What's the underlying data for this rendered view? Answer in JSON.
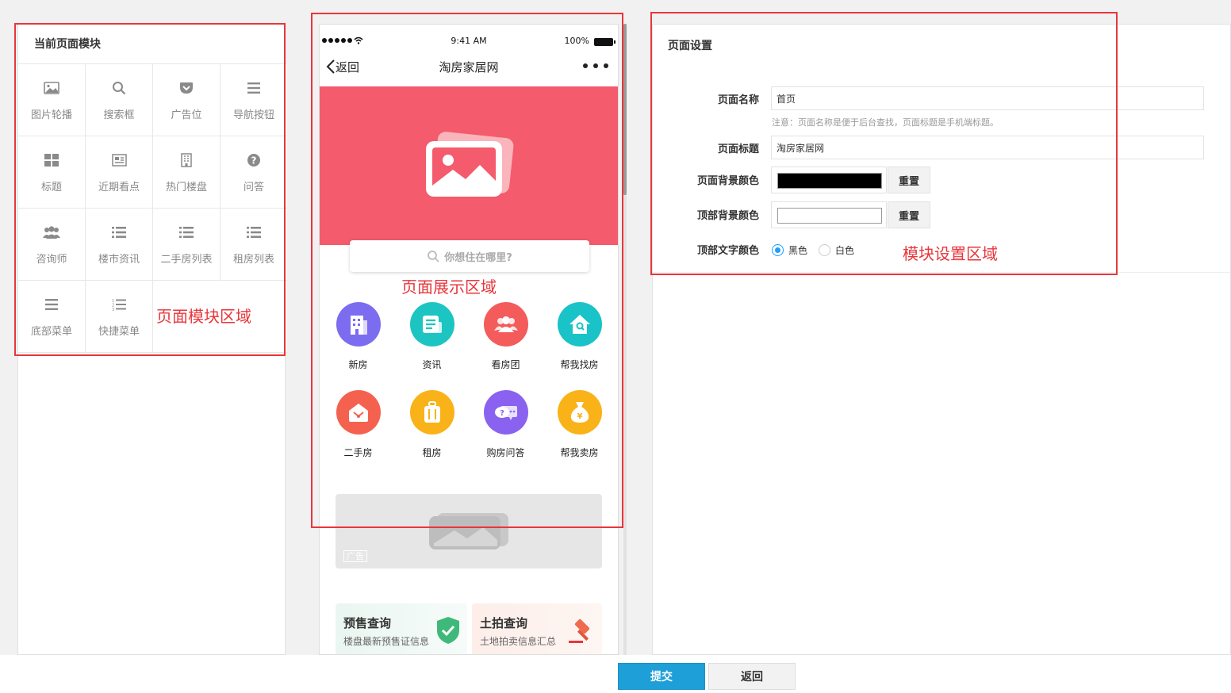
{
  "left_panel": {
    "title": "当前页面模块",
    "modules": [
      {
        "label": "图片轮播",
        "icon": "image-icon"
      },
      {
        "label": "搜索框",
        "icon": "search-icon"
      },
      {
        "label": "广告位",
        "icon": "pocket-icon"
      },
      {
        "label": "导航按钮",
        "icon": "menu-icon"
      },
      {
        "label": "标题",
        "icon": "grid-icon"
      },
      {
        "label": "近期看点",
        "icon": "newspaper-icon"
      },
      {
        "label": "热门楼盘",
        "icon": "building-icon"
      },
      {
        "label": "问答",
        "icon": "question-icon"
      },
      {
        "label": "咨询师",
        "icon": "users-icon"
      },
      {
        "label": "楼市资讯",
        "icon": "list-icon"
      },
      {
        "label": "二手房列表",
        "icon": "list-icon"
      },
      {
        "label": "租房列表",
        "icon": "list-icon"
      },
      {
        "label": "底部菜单",
        "icon": "menu-icon"
      },
      {
        "label": "快捷菜单",
        "icon": "list-ordered-icon"
      }
    ],
    "annotation": "页面模块区域"
  },
  "phone": {
    "status_time": "9:41 AM",
    "battery_text": "100%",
    "back_label": "返回",
    "nav_title": "淘房家居网",
    "search_placeholder": "你想住在哪里?",
    "annotation": "页面展示区域",
    "nav_items": [
      {
        "label": "新房",
        "color": "#7b6cf0",
        "icon": "building-icon"
      },
      {
        "label": "资讯",
        "color": "#1cc5c2",
        "icon": "news-icon"
      },
      {
        "label": "看房团",
        "color": "#f45b5b",
        "icon": "group-icon"
      },
      {
        "label": "帮我找房",
        "color": "#19c3c7",
        "icon": "house-search-icon"
      },
      {
        "label": "二手房",
        "color": "#f4624f",
        "icon": "house-icon"
      },
      {
        "label": "租房",
        "color": "#f9b218",
        "icon": "luggage-icon"
      },
      {
        "label": "购房问答",
        "color": "#8a62f0",
        "icon": "chat-icon"
      },
      {
        "label": "帮我卖房",
        "color": "#f9b218",
        "icon": "money-bag-icon"
      }
    ],
    "ad_tag": "广告",
    "promos": [
      {
        "title": "预售查询",
        "subtitle": "楼盘最新预售证信息",
        "icon": "shield-check-icon"
      },
      {
        "title": "土拍查询",
        "subtitle": "土地拍卖信息汇总",
        "icon": "gavel-icon"
      }
    ],
    "banner_color": "#f45b6c"
  },
  "settings": {
    "title": "页面设置",
    "page_name_label": "页面名称",
    "page_name_value": "首页",
    "page_name_hint": "注意：页面名称是便于后台查找，页面标题是手机端标题。",
    "page_title_label": "页面标题",
    "page_title_value": "淘房家居网",
    "bg_color_label": "页面背景颜色",
    "bg_color_value": "#000000",
    "top_bg_color_label": "顶部背景颜色",
    "top_bg_color_value": "#ffffff",
    "reset_label": "重置",
    "top_text_color_label": "顶部文字颜色",
    "radio_black": "黑色",
    "radio_white": "白色",
    "radio_selected": "黑色",
    "annotation": "模块设置区域"
  },
  "footer": {
    "submit_label": "提交",
    "return_label": "返回"
  },
  "colors": {
    "annotation_red": "#e8363b",
    "primary_blue": "#1e9fd8"
  }
}
